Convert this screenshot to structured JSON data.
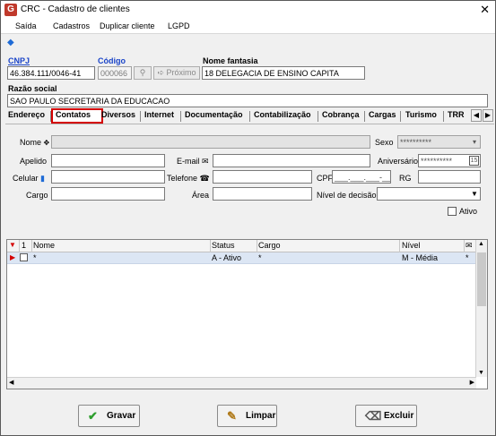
{
  "window": {
    "title": "CRC - Cadastro de clientes",
    "close_glyph": "✕",
    "app_icon_letter": "G"
  },
  "menu": [
    "Saída",
    "Cadastros",
    "Duplicar cliente",
    "LGPD"
  ],
  "header": {
    "cnpj_label": "CNPJ",
    "cnpj_value": "46.384.111/0046-41",
    "codigo_label": "Código",
    "codigo_value": "000066",
    "proximo_label": "Próximo",
    "nome_fantasia_label": "Nome fantasia",
    "nome_fantasia_value": "18 DELEGACIA DE ENSINO  CAPITA",
    "razao_social_label": "Razão social",
    "razao_social_value": "SAO PAULO SECRETARIA DA EDUCACAO"
  },
  "tabs": [
    "Endereço",
    "Contatos",
    "Diversos",
    "Internet",
    "Documentação",
    "Contabilização",
    "Cobrança",
    "Cargas",
    "Turismo",
    "TRR"
  ],
  "active_tab": "Contatos",
  "form": {
    "nome_label": "Nome",
    "sexo_label": "Sexo",
    "sexo_value": "**********",
    "apelido_label": "Apelido",
    "email_label": "E-mail",
    "aniversario_label": "Aniversário",
    "aniversario_value": "**********",
    "celular_label": "Celular",
    "telefone_label": "Telefone",
    "cpf_label": "CPF",
    "cpf_mask": "___.___.___-__",
    "rg_label": "RG",
    "cargo_label": "Cargo",
    "area_label": "Área",
    "nivel_decisao_label": "Nível de decisão",
    "ativo_label": "Ativo"
  },
  "grid": {
    "columns": [
      "Nome",
      "Status",
      "Cargo",
      "Nível"
    ],
    "rows": [
      {
        "nome": "*",
        "status": "A - Ativo",
        "cargo": "*",
        "nivel": "M - Média",
        "extra": "*"
      }
    ],
    "row_number_header": "1"
  },
  "footer": {
    "gravar": "Gravar",
    "limpar": "Limpar",
    "excluir": "Excluir"
  },
  "colors": {
    "accent_red": "#d40000",
    "link_blue": "#1a44c8",
    "selection": "#dce6f4"
  }
}
